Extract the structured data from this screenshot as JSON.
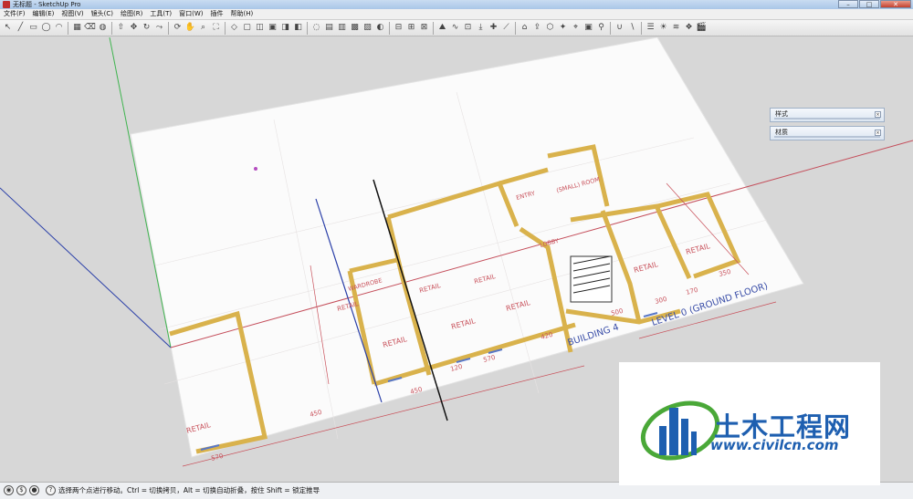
{
  "window": {
    "title": "无标题 - SketchUp Pro",
    "controls": {
      "minimize": "–",
      "maximize": "□",
      "close": "✕"
    }
  },
  "menu": {
    "items": [
      "文件(F)",
      "编辑(E)",
      "视图(V)",
      "镜头(C)",
      "绘图(R)",
      "工具(T)",
      "窗口(W)",
      "插件",
      "帮助(H)"
    ]
  },
  "toolbar": {
    "groups": [
      [
        "select-icon",
        "line-icon",
        "rectangle-icon",
        "circle-icon",
        "arc-icon"
      ],
      [
        "make-component-icon",
        "eraser-icon",
        "paint-bucket-icon"
      ],
      [
        "push-pull-icon",
        "move-icon",
        "rotate-icon",
        "follow-me-icon"
      ],
      [
        "orbit-icon",
        "pan-icon",
        "zoom-icon",
        "zoom-extents-icon"
      ],
      [
        "iso-view-icon",
        "top-view-icon",
        "front-view-icon",
        "right-view-icon",
        "back-view-icon",
        "left-view-icon"
      ],
      [
        "xray-icon",
        "wireframe-icon",
        "hidden-line-icon",
        "shaded-icon",
        "textured-icon",
        "monochrome-icon"
      ],
      [
        "section-plane-icon",
        "display-sections-icon",
        "section-cut-icon"
      ],
      [
        "sandbox-icon",
        "smoove-icon",
        "stamp-icon",
        "drape-icon",
        "add-detail-icon",
        "flip-edge-icon"
      ],
      [
        "warehouse-icon",
        "share-model-icon",
        "component-icon",
        "extension-icon",
        "geo-location-icon",
        "photo-texture-icon",
        "walk-icon"
      ],
      [
        "solid-union-icon",
        "solid-subtract-icon"
      ],
      [
        "layer-icon",
        "shadow-icon",
        "fog-icon",
        "style-icon",
        "scene-icon"
      ]
    ]
  },
  "trays": [
    {
      "label": "样式"
    },
    {
      "label": "材质"
    }
  ],
  "drawing": {
    "rooms": [
      "RETAIL",
      "RETAIL",
      "RETAIL",
      "RETAIL",
      "RETAIL",
      "RETAIL",
      "RETAIL",
      "RETAIL",
      "RETAIL"
    ],
    "labels": [
      "WARDROBE",
      "ENTRY",
      "LOBBY",
      "(SMALL) ROOM",
      "BUILDING 4",
      "LEVEL 0  (GROUND FLOOR)"
    ],
    "dimensions": [
      "450",
      "450",
      "120",
      "570",
      "420",
      "500",
      "300",
      "170",
      "350",
      "570"
    ]
  },
  "status": {
    "message": "选择两个点进行移动。Ctrl = 切换拷贝，Alt = 切换自动折叠，按住 Shift = 锁定推导"
  },
  "watermark": {
    "title": "土木工程网",
    "url": "www.civilcn.com"
  },
  "colors": {
    "wall": "#d9b24c",
    "red_axis": "#c44d5a",
    "green_axis": "#3fb44f",
    "blue_axis": "#2a3fa8",
    "brand": "#1e5fb0"
  }
}
